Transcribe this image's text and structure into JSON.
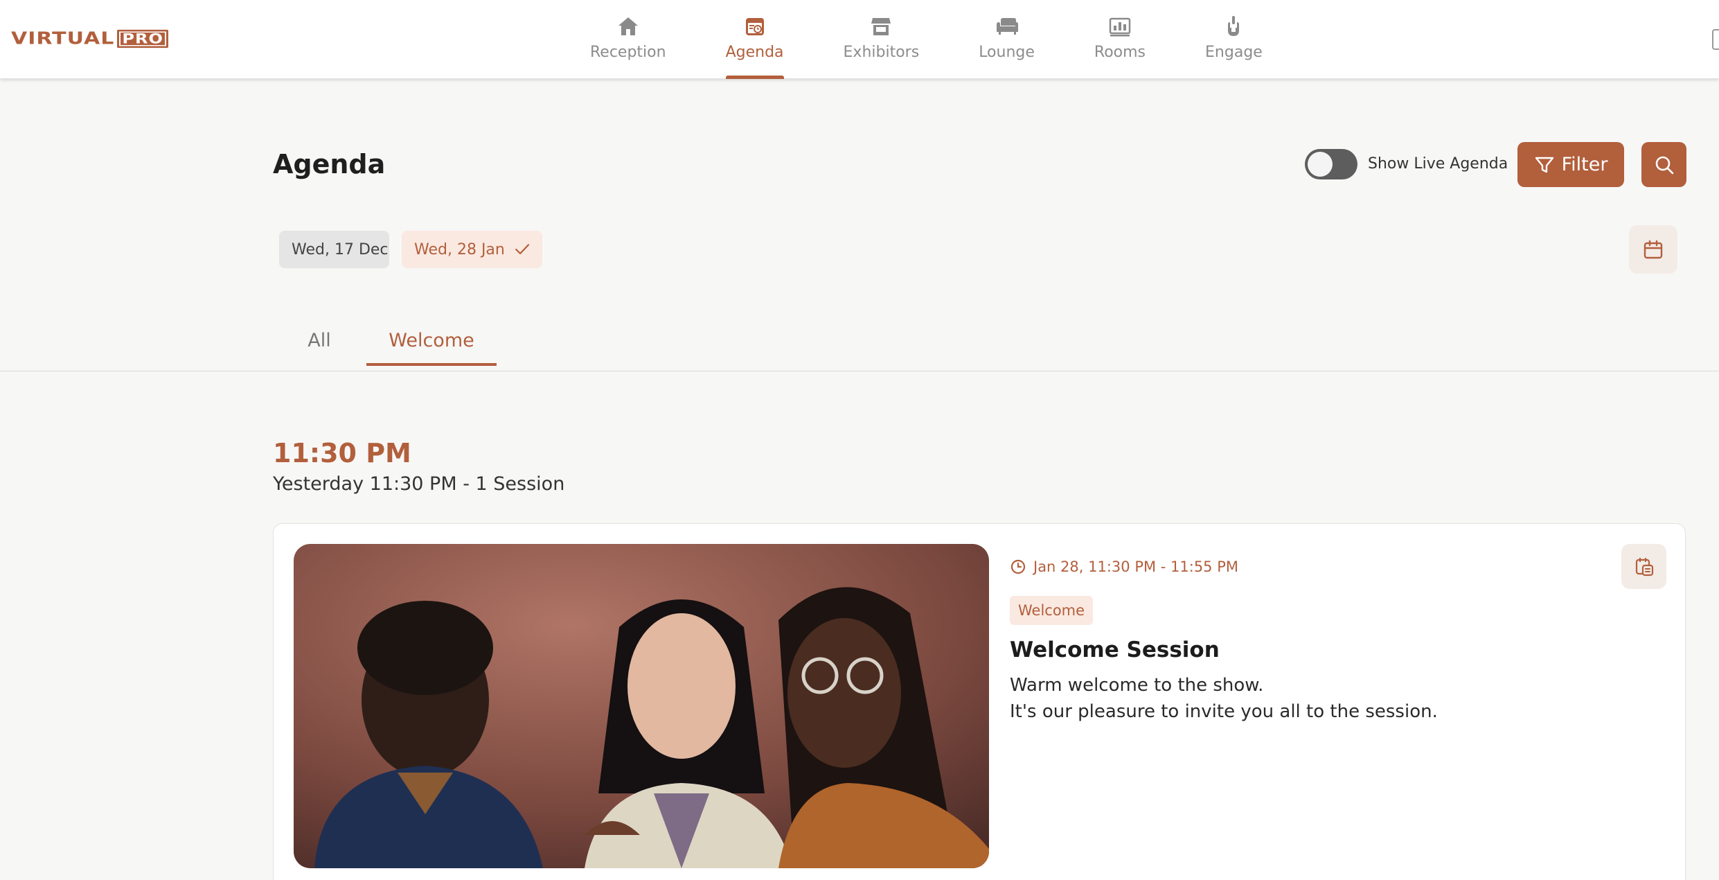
{
  "brand": {
    "logo_word": "VIRTUAL",
    "logo_badge": "PRO",
    "accent_color": "#b25f3c"
  },
  "nav": {
    "items": [
      {
        "label": "Reception",
        "icon": "home-icon"
      },
      {
        "label": "Agenda",
        "icon": "agenda-calendar-icon",
        "active": true
      },
      {
        "label": "Exhibitors",
        "icon": "storefront-icon"
      },
      {
        "label": "Lounge",
        "icon": "sofa-icon"
      },
      {
        "label": "Rooms",
        "icon": "rooms-icon"
      },
      {
        "label": "Engage",
        "icon": "hand-point-icon"
      }
    ]
  },
  "header": {
    "title": "Agenda",
    "live_toggle_label": "Show Live Agenda",
    "live_toggle_on": false,
    "filter_label": "Filter"
  },
  "dates": {
    "chips": [
      {
        "label": "Wed, 17 Dec",
        "selected": false
      },
      {
        "label": "Wed, 28 Jan",
        "selected": true
      }
    ]
  },
  "tabs": {
    "items": [
      {
        "label": "All",
        "active": false
      },
      {
        "label": "Welcome",
        "active": true
      }
    ]
  },
  "group": {
    "time": "11:30 PM",
    "subtitle": "Yesterday 11:30 PM - 1  Session"
  },
  "session": {
    "time_range": "Jan 28, 11:30 PM - 11:55 PM",
    "tag": "Welcome",
    "title": "Welcome Session",
    "description_lines": [
      "Warm welcome to the show.",
      "It's our pleasure to invite you all to the session."
    ]
  }
}
